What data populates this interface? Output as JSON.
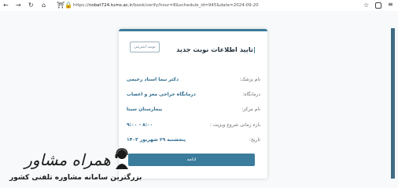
{
  "browser": {
    "url_prefix": "https://",
    "url_host": "nobat724.tums.ac.ir",
    "url_path": "/book/verify/hour=8&schedule_id=945&date=2024-09-20"
  },
  "card": {
    "title": "تایید اطلاعات نوبت جدید",
    "edit_button": "نوبت اینترنتی",
    "rows": [
      {
        "label": "نام پزشک:",
        "value": "دکتر نیما استاد رحیمی"
      },
      {
        "label": "درمانگاه:",
        "value": "درمانگاه جراحی مغز و اعصاب"
      },
      {
        "label": "نام مرکز:",
        "value": "بیمارستان سینا"
      },
      {
        "label": "بازه زمانی شروع ویزیت :",
        "value": "۸:۰۰ - ۹:۰۰"
      },
      {
        "label": "تاریخ:",
        "value": "پنجشنبه ۲۹ شهریور ۱۴۰۳"
      }
    ],
    "confirm_button": "ادامه"
  },
  "watermark": {
    "title": "همراه مشاور",
    "subtitle": "بزرگترین سامانه مشاوره تلفنی کشور"
  },
  "colors": {
    "accent": "#3b7c9d",
    "value_text": "#2c6a8c",
    "scrollbar": "#3f6c85"
  }
}
